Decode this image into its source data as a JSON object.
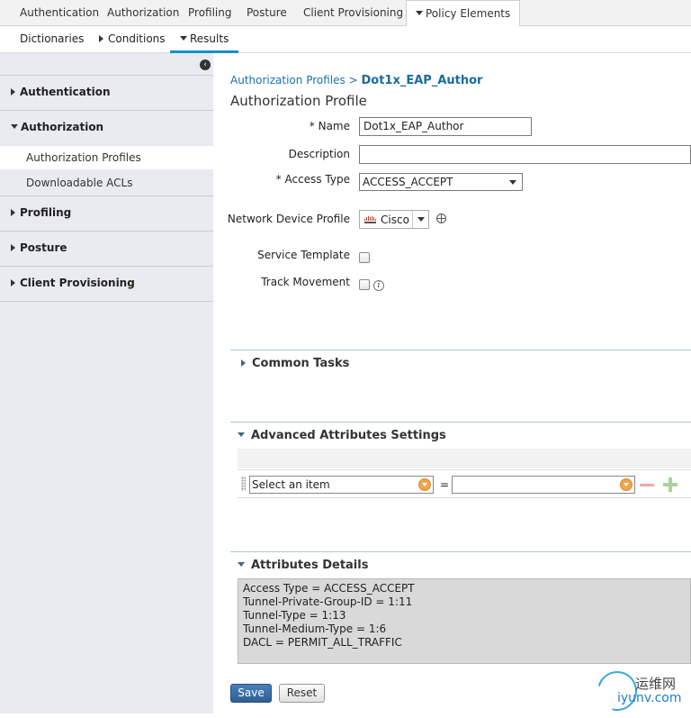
{
  "top_tabs": [
    {
      "label": "Authentication"
    },
    {
      "label": "Authorization"
    },
    {
      "label": "Profiling"
    },
    {
      "label": "Posture"
    },
    {
      "label": "Client Provisioning"
    },
    {
      "label": "Policy Elements",
      "active": true
    }
  ],
  "sub_tabs": [
    {
      "label": "Dictionaries"
    },
    {
      "label": "Conditions"
    },
    {
      "label": "Results",
      "active": true
    }
  ],
  "sidebar": {
    "collapse_icon": "chevron-left-icon",
    "sections": [
      {
        "label": "Authentication",
        "expanded": false
      },
      {
        "label": "Authorization",
        "expanded": true,
        "items": [
          {
            "label": "Authorization Profiles",
            "selected": true
          },
          {
            "label": "Downloadable ACLs"
          }
        ]
      },
      {
        "label": "Profiling",
        "expanded": false
      },
      {
        "label": "Posture",
        "expanded": false
      },
      {
        "label": "Client Provisioning",
        "expanded": false
      }
    ]
  },
  "breadcrumb": {
    "parent": "Authorization Profiles",
    "separator": ">",
    "current": "Dot1x_EAP_Author"
  },
  "page_title": "Authorization Profile",
  "form": {
    "name_label": "* Name",
    "name_value": "Dot1x_EAP_Author",
    "description_label": "Description",
    "description_value": "",
    "access_type_label": "* Access Type",
    "access_type_value": "ACCESS_ACCEPT",
    "ndp_label": "Network Device Profile",
    "ndp_value": "Cisco",
    "service_template_label": "Service Template",
    "service_template_checked": false,
    "track_movement_label": "Track Movement",
    "track_movement_checked": false
  },
  "common_tasks": {
    "label": "Common Tasks",
    "expanded": false
  },
  "advanced": {
    "label": "Advanced Attributes Settings",
    "expanded": true,
    "row": {
      "left_value": "Select an item",
      "operator": "=",
      "right_value": ""
    }
  },
  "details": {
    "label": "Attributes Details",
    "lines": [
      "Access Type = ACCESS_ACCEPT",
      "Tunnel-Private-Group-ID = 1:11",
      "Tunnel-Type = 1:13",
      "Tunnel-Medium-Type = 1:6",
      "DACL = PERMIT_ALL_TRAFFIC"
    ]
  },
  "buttons": {
    "save": "Save",
    "reset": "Reset"
  },
  "watermark": {
    "cn": "运维网",
    "en": "iyunv.com"
  },
  "colors": {
    "accent": "#1a8fc9",
    "link": "#1a73a8",
    "save_button": "#3d6fa8",
    "sidebar_bg": "#e9ebf1"
  }
}
